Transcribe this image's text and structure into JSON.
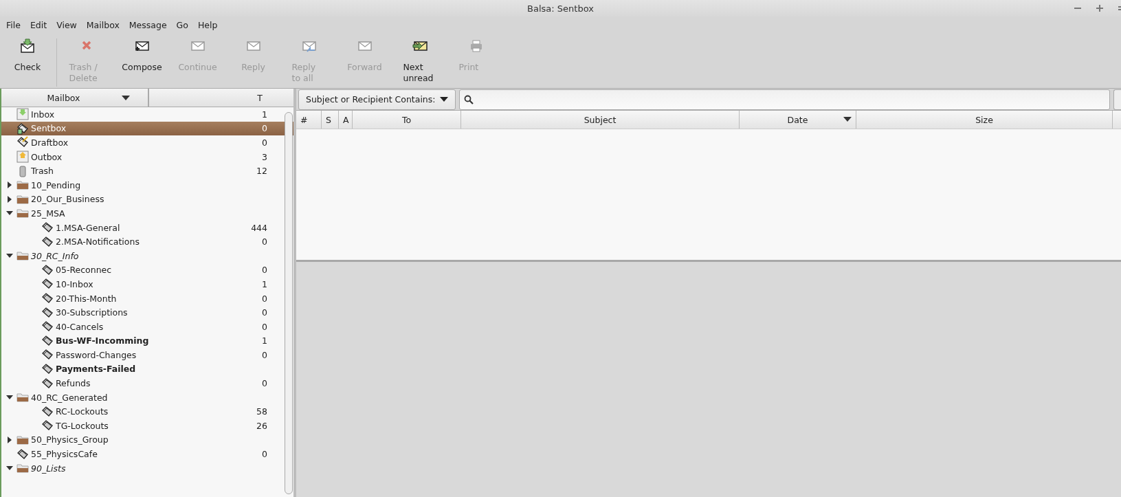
{
  "window": {
    "title": "Balsa: Sentbox"
  },
  "menu": [
    "File",
    "Edit",
    "View",
    "Mailbox",
    "Message",
    "Go",
    "Help"
  ],
  "toolbar": [
    {
      "label": "Check",
      "kind": "check",
      "disabled": false
    },
    {
      "label": "Trash / Delete",
      "kind": "trash",
      "disabled": true
    },
    {
      "label": "Compose",
      "kind": "compose",
      "disabled": false
    },
    {
      "label": "Continue",
      "kind": "continue",
      "disabled": true
    },
    {
      "label": "Reply",
      "kind": "reply",
      "disabled": true
    },
    {
      "label": "Reply to all",
      "kind": "replyall",
      "disabled": true
    },
    {
      "label": "Forward",
      "kind": "forward",
      "disabled": true
    },
    {
      "label": "Next unread",
      "kind": "next",
      "disabled": false
    },
    {
      "label": "Print",
      "kind": "print",
      "disabled": true
    }
  ],
  "sidebar": {
    "columns": [
      {
        "label": "Mailbox",
        "sorted": true
      },
      {
        "label": "T",
        "sorted": false
      }
    ],
    "items": [
      {
        "name": "Inbox",
        "count": "1",
        "kind": "inbox",
        "selected": false,
        "bold": false,
        "italic": false
      },
      {
        "name": "Sentbox",
        "count": "0",
        "kind": "sentbox",
        "selected": true,
        "bold": false,
        "italic": false
      },
      {
        "name": "Draftbox",
        "count": "0",
        "kind": "draftbox",
        "selected": false,
        "bold": false,
        "italic": false
      },
      {
        "name": "Outbox",
        "count": "3",
        "kind": "outbox",
        "selected": false,
        "bold": false,
        "italic": false
      },
      {
        "name": "Trash",
        "count": "12",
        "kind": "trash",
        "selected": false,
        "bold": false,
        "italic": false
      },
      {
        "name": "10_Pending",
        "kind": "folder",
        "expanded": false,
        "selected": false,
        "bold": false,
        "italic": false
      },
      {
        "name": "20_Our_Business",
        "kind": "folder",
        "expanded": false,
        "selected": false,
        "bold": false,
        "italic": false
      },
      {
        "name": "25_MSA",
        "kind": "folder",
        "expanded": true,
        "selected": false,
        "bold": false,
        "italic": false,
        "children": [
          {
            "name": "1.MSA-General",
            "count": "444",
            "kind": "mailbox",
            "selected": false,
            "bold": false,
            "italic": false
          },
          {
            "name": "2.MSA-Notifications",
            "count": "0",
            "kind": "mailbox",
            "selected": false,
            "bold": false,
            "italic": false
          }
        ]
      },
      {
        "name": "30_RC_Info",
        "kind": "folder",
        "expanded": true,
        "selected": false,
        "bold": false,
        "italic": true,
        "children": [
          {
            "name": "05-Reconnec",
            "count": "0",
            "kind": "mailbox",
            "selected": false,
            "bold": false,
            "italic": false
          },
          {
            "name": "10-Inbox",
            "count": "1",
            "kind": "mailbox",
            "selected": false,
            "bold": false,
            "italic": false
          },
          {
            "name": "20-This-Month",
            "count": "0",
            "kind": "mailbox",
            "selected": false,
            "bold": false,
            "italic": false
          },
          {
            "name": "30-Subscriptions",
            "count": "0",
            "kind": "mailbox",
            "selected": false,
            "bold": false,
            "italic": false
          },
          {
            "name": "40-Cancels",
            "count": "0",
            "kind": "mailbox",
            "selected": false,
            "bold": false,
            "italic": false
          },
          {
            "name": "Bus-WF-Incomming",
            "count": "1",
            "kind": "mailbox",
            "selected": false,
            "bold": true,
            "italic": false
          },
          {
            "name": "Password-Changes",
            "count": "0",
            "kind": "mailbox",
            "selected": false,
            "bold": false,
            "italic": false
          },
          {
            "name": "Payments-Failed",
            "kind": "mailbox",
            "selected": false,
            "bold": true,
            "italic": false
          },
          {
            "name": "Refunds",
            "count": "0",
            "kind": "mailbox",
            "selected": false,
            "bold": false,
            "italic": false
          }
        ]
      },
      {
        "name": "40_RC_Generated",
        "kind": "folder",
        "expanded": true,
        "selected": false,
        "bold": false,
        "italic": false,
        "children": [
          {
            "name": "RC-Lockouts",
            "count": "58",
            "kind": "mailbox",
            "selected": false,
            "bold": false,
            "italic": false
          },
          {
            "name": "TG-Lockouts",
            "count": "26",
            "kind": "mailbox",
            "selected": false,
            "bold": false,
            "italic": false
          }
        ]
      },
      {
        "name": "50_Physics_Group",
        "kind": "folder",
        "expanded": false,
        "selected": false,
        "bold": false,
        "italic": false
      },
      {
        "name": "55_PhysicsCafe",
        "count": "0",
        "kind": "mailbox",
        "selected": false,
        "bold": false,
        "italic": false
      },
      {
        "name": "90_Lists",
        "kind": "folder",
        "expanded": true,
        "selected": false,
        "bold": false,
        "italic": true
      }
    ]
  },
  "filter": {
    "label": "Subject or Recipient Contains:"
  },
  "table": {
    "columns": [
      {
        "label": "#",
        "sorted": false
      },
      {
        "label": "S",
        "sorted": false
      },
      {
        "label": "A",
        "sorted": false
      },
      {
        "label": "To",
        "sorted": false
      },
      {
        "label": "Subject",
        "sorted": false
      },
      {
        "label": "Date",
        "sorted": true
      },
      {
        "label": "Size",
        "sorted": false
      }
    ]
  }
}
